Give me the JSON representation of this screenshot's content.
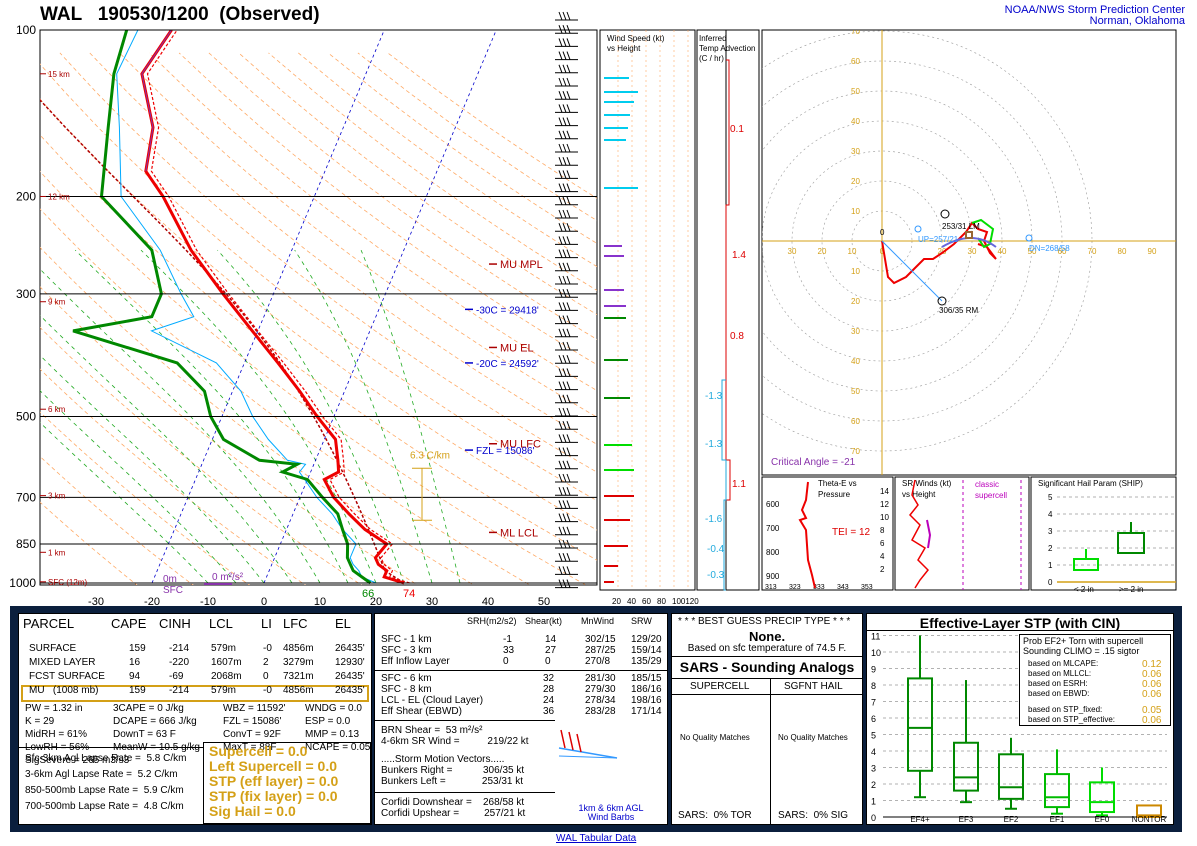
{
  "header": {
    "title": "WAL   190530/1200  (Observed)",
    "org_line1": "NOAA/NWS Storm Prediction Center",
    "org_line2": "Norman, Oklahoma"
  },
  "colors": {
    "temperature": "#ee0000",
    "dewpoint": "#008800",
    "virtual_temp": "#ee0000",
    "parcel": "#b00000",
    "wetbulb": "#00aaff",
    "dry_adiabats": "#ffaa66",
    "moist_adiabats": "#22aa22",
    "label_red": "#aa0000",
    "label_blue": "#0000cc",
    "effective_layer": "#d4a017",
    "hodo_tick": "#d4a017",
    "panel_bg": "#0b1f3d"
  },
  "chart_data": [
    {
      "type": "line",
      "name": "skewt",
      "y_ticks": [
        "100",
        "200",
        "300",
        "500",
        "700",
        "850",
        "1000"
      ],
      "x_ticks": [
        "-30",
        "-20",
        "-10",
        "0",
        "10",
        "20",
        "30",
        "40",
        "50"
      ],
      "height_labels": [
        "15 km",
        "12 km",
        "9 km",
        "6 km",
        "3 km",
        "1 km",
        "SFC (12m)"
      ],
      "temperature": [
        [
          1000,
          25
        ],
        [
          975,
          21
        ],
        [
          950,
          21
        ],
        [
          925,
          19
        ],
        [
          900,
          18
        ],
        [
          850,
          19
        ],
        [
          800,
          14
        ],
        [
          750,
          10
        ],
        [
          700,
          6
        ],
        [
          650,
          3
        ],
        [
          630,
          5
        ],
        [
          600,
          4
        ],
        [
          550,
          2
        ],
        [
          500,
          -3
        ],
        [
          450,
          -8
        ],
        [
          400,
          -14
        ],
        [
          350,
          -21
        ],
        [
          300,
          -29
        ],
        [
          250,
          -38
        ],
        [
          200,
          -47
        ],
        [
          180,
          -52
        ],
        [
          150,
          -54
        ],
        [
          120,
          -60
        ],
        [
          100,
          -58
        ]
      ],
      "dewpoint": [
        [
          1000,
          19
        ],
        [
          975,
          17
        ],
        [
          950,
          15
        ],
        [
          925,
          14
        ],
        [
          900,
          13
        ],
        [
          850,
          12
        ],
        [
          800,
          10
        ],
        [
          750,
          8
        ],
        [
          700,
          4
        ],
        [
          650,
          0
        ],
        [
          630,
          -5
        ],
        [
          610,
          -3
        ],
        [
          600,
          -10
        ],
        [
          550,
          -18
        ],
        [
          500,
          -22
        ],
        [
          450,
          -25
        ],
        [
          400,
          -32
        ],
        [
          350,
          -53
        ],
        [
          330,
          -40
        ],
        [
          300,
          -40
        ],
        [
          250,
          -45
        ],
        [
          200,
          -58
        ],
        [
          150,
          -62
        ],
        [
          120,
          -65
        ],
        [
          100,
          -66
        ]
      ],
      "annotations": [
        "MU MPL",
        "MU EL",
        "MU LFC",
        "ML LCL",
        "-30C = 29418'",
        "-20C = 24592'",
        "FZL = 15086'",
        "6.3 C/km"
      ],
      "surface_temp_label": "74",
      "surface_dew_label": "66",
      "bottom_labels": [
        "0m",
        "SFC",
        "0 m²/s²"
      ]
    },
    {
      "type": "bar",
      "name": "wind_speed_vs_height",
      "title": "Wind Speed (kt) vs Height",
      "x_ticks": [
        "20",
        "40",
        "60",
        "80",
        "100120"
      ]
    },
    {
      "type": "line",
      "name": "inferred_temp_advection",
      "title": "Inferred Temp Advection (C / hr)",
      "values": [
        "0.1",
        "1.4",
        "0.8",
        "-1.3",
        "-1.3",
        "1.1",
        "-1.6",
        "-0.4",
        "-0.3"
      ]
    },
    {
      "type": "line",
      "name": "hodograph",
      "rings": [
        10,
        20,
        30,
        40,
        50,
        60,
        70
      ],
      "tick_labels": [
        "30",
        "20",
        "10",
        "0",
        "20",
        "30",
        "40",
        "50",
        "60",
        "70",
        "80",
        "90",
        "100"
      ],
      "y_tick_labels": [
        "70",
        "60",
        "50",
        "40",
        "30",
        "20",
        "10",
        "10",
        "20",
        "30",
        "40",
        "50",
        "60",
        "70"
      ],
      "lm_label": "253/31 LM",
      "rm_label": "306/35 RM",
      "up_label": "UP=257/21",
      "dn_label": "DN=268/58",
      "critical_angle": "Critical Angle = -21"
    },
    {
      "type": "line",
      "name": "theta_e_vs_pressure",
      "title": "Theta-E vs Pressure",
      "y_ticks": [
        "600",
        "700",
        "800",
        "900"
      ],
      "x_ticks": [
        "313",
        "323",
        "333",
        "343",
        "353"
      ],
      "tei": "TEI = 12"
    },
    {
      "type": "line",
      "name": "sr_winds_vs_height",
      "title": "SR Winds (kt) vs Height",
      "note": "classic supercell",
      "y_ticks": [
        "14",
        "12",
        "10",
        "8",
        "6",
        "4",
        "2"
      ]
    },
    {
      "type": "table",
      "name": "ship",
      "title": "Significant Hail Param (SHIP)",
      "y_ticks": [
        "5",
        "4",
        "3",
        "2",
        "1",
        "0"
      ],
      "x_labels": [
        "< 2 in",
        ">= 2 in"
      ]
    },
    {
      "type": "table",
      "name": "stp_boxplot",
      "title": "Effective-Layer STP (with CIN)",
      "y_ticks": [
        "11",
        "10",
        "9",
        "8",
        "7",
        "6",
        "5",
        "4",
        "3",
        "2",
        "1",
        "0"
      ],
      "categories": [
        "EF4+",
        "EF3",
        "EF2",
        "EF1",
        "EF0",
        "NONTOR"
      ],
      "boxes": [
        {
          "min": 1.2,
          "q1": 2.8,
          "median": 5.4,
          "q3": 8.4,
          "max": 11.0
        },
        {
          "min": 0.9,
          "q1": 1.6,
          "median": 2.4,
          "q3": 4.5,
          "max": 8.3
        },
        {
          "min": 0.5,
          "q1": 1.1,
          "median": 1.8,
          "q3": 3.8,
          "max": 4.8
        },
        {
          "min": 0.2,
          "q1": 0.6,
          "median": 1.2,
          "q3": 2.6,
          "max": 4.1
        },
        {
          "min": 0.1,
          "q1": 0.3,
          "median": 0.9,
          "q3": 2.1,
          "max": 3.0
        },
        {
          "min": 0.0,
          "q1": 0.0,
          "median": 0.1,
          "q3": 0.7,
          "max": 0.7
        }
      ]
    }
  ],
  "parcels": {
    "headers": [
      "PARCEL",
      "CAPE",
      "CINH",
      "LCL",
      "LI",
      "LFC",
      "EL"
    ],
    "rows": [
      [
        "SURFACE",
        "159",
        "-214",
        "579m",
        "-0",
        "4856m",
        "26435'"
      ],
      [
        "MIXED LAYER",
        "16",
        "-220",
        "1607m",
        "2",
        "3279m",
        "12930'"
      ],
      [
        "FCST SURFACE",
        "94",
        "-69",
        "2068m",
        "0",
        "7321m",
        "26435'"
      ],
      [
        "MU   (1008 mb)",
        "159",
        "-214",
        "579m",
        "-0",
        "4856m",
        "26435'"
      ]
    ]
  },
  "indices": {
    "col1": [
      "PW = 1.32 in",
      "K = 29",
      "MidRH = 61%",
      "LowRH = 56%",
      "SigSevere = 265 m3/s3"
    ],
    "col2": [
      "3CAPE = 0 J/kg",
      "DCAPE = 666 J/kg",
      "DownT = 63 F",
      "MeanW = 10.5 g/kg"
    ],
    "col3": [
      "WBZ = 11592'",
      "FZL = 15086'",
      "ConvT = 92F",
      "MaxT = 88F"
    ],
    "col4": [
      "WNDG = 0.0",
      "ESP = 0.0",
      "MMP = 0.13",
      "NCAPE = 0.05"
    ]
  },
  "lapse_rates": [
    "Sfc-3km Agl Lapse Rate =  5.8 C/km",
    "3-6km Agl Lapse Rate =  5.2 C/km",
    "850-500mb Lapse Rate =  5.9 C/km",
    "700-500mb Lapse Rate =  4.8 C/km"
  ],
  "composite": [
    "Supercell = 0.0",
    "Left Supercell = 0.0",
    "STP (eff layer) = 0.0",
    "STP (fix layer) = 0.0",
    "Sig Hail = 0.0"
  ],
  "kinematics": {
    "headers": [
      "SRH(m2/s2)",
      "Shear(kt)",
      "MnWind",
      "SRW"
    ],
    "rows": [
      [
        "SFC - 1 km",
        "-1",
        "14",
        "302/15",
        "129/20"
      ],
      [
        "SFC - 3 km",
        "33",
        "27",
        "287/25",
        "159/14"
      ],
      [
        "Eff Inflow Layer",
        "0",
        "0",
        "270/8",
        "135/29"
      ],
      [
        "SFC - 6 km",
        "32",
        "281/30",
        "185/15",
        ""
      ],
      [
        "SFC - 8 km",
        "28",
        "279/30",
        "186/16",
        ""
      ],
      [
        "LCL - EL (Cloud Layer)",
        "24",
        "278/34",
        "198/16",
        ""
      ],
      [
        "Eff Shear (EBWD)",
        "36",
        "283/28",
        "171/14",
        ""
      ]
    ],
    "brn_shear": "BRN Shear =  53 m²/s²",
    "sr_wind": "4-6km SR Wind =          219/22 kt",
    "storm_motion_title": ".....Storm Motion Vectors.....",
    "bunkers_right": "Bunkers Right =           306/35 kt",
    "bunkers_left": "Bunkers Left =             253/31 kt",
    "corfidi_down": "Corfidi Downshear =    268/58 kt",
    "corfidi_up": "Corfidi Upshear =         257/21 kt",
    "barb_caption": "1km & 6km AGL Wind Barbs"
  },
  "precip": {
    "title": "* * * BEST GUESS PRECIP TYPE * * *",
    "value": "None.",
    "note": "Based on sfc temperature of 74.5 F."
  },
  "sars": {
    "title": "SARS - Sounding Analogs",
    "col1": "SUPERCELL",
    "col2": "SGFNT HAIL",
    "no_match": "No Quality Matches",
    "tor": "SARS:  0% TOR",
    "sig": "SARS:  0% SIG"
  },
  "stp_probs": {
    "header1": "Prob EF2+ Torn with supercell",
    "header2": "Sounding CLIMO = .15 sigtor",
    "rows": [
      [
        "based on MLCAPE:",
        "0.12"
      ],
      [
        "based on MLLCL:",
        "0.06"
      ],
      [
        "based on ESRH:",
        "0.06"
      ],
      [
        "based on EBWD:",
        "0.06"
      ],
      [
        "based on STP_fixed:",
        "0.05"
      ],
      [
        "based on STP_effective:",
        "0.06"
      ]
    ]
  },
  "footer": {
    "link": "WAL Tabular Data"
  }
}
